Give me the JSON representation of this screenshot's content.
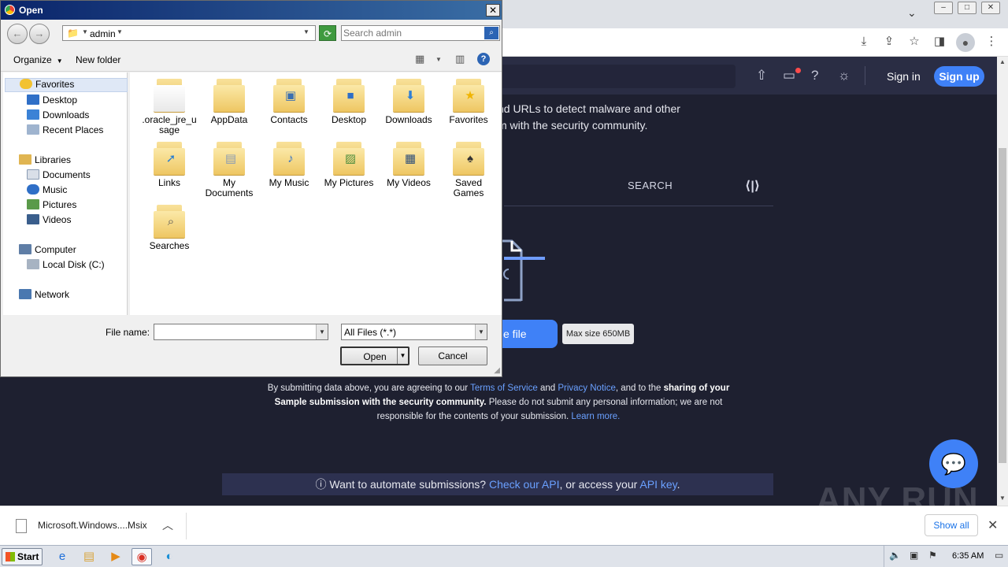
{
  "browser": {
    "window_controls": [
      "–",
      "□",
      "✕"
    ],
    "omnibar_icons": [
      "download-icon",
      "share-icon",
      "star-icon",
      "sidepanel-icon",
      "profile-icon",
      "menu-icon"
    ]
  },
  "page": {
    "header": {
      "sign_in": "Sign in",
      "sign_up": "Sign up"
    },
    "intro": [
      "nd URLs to detect malware and other",
      "m with the security community."
    ],
    "tab_search": "SEARCH",
    "choose_file": "e file",
    "max_size": "Max size 650MB",
    "legal": {
      "p1": "By submitting data above, you are agreeing to our ",
      "terms": "Terms of Service",
      "and": " and ",
      "privacy": "Privacy Notice",
      "p2": ", and to the ",
      "bold": "sharing of your Sample submission with the security community.",
      "p3": " Please do not submit any personal information; we are not responsible for the contents of your submission. ",
      "learn": "Learn more."
    },
    "api_bar": {
      "prefix": "ⓘ Want to automate submissions? ",
      "check_api": "Check our API",
      "middle": ", or access your ",
      "api_key": "API key",
      "suffix": "."
    },
    "watermark": "ANY RUN"
  },
  "download_bar": {
    "file_name": "Microsoft.Windows....Msix",
    "show_all": "Show all"
  },
  "taskbar": {
    "start": "Start",
    "clock": "6:35 AM"
  },
  "dialog": {
    "title": "Open",
    "address": "admin",
    "search_placeholder": "Search admin",
    "organize": "Organize",
    "new_folder": "New folder",
    "nav": {
      "favorites": "Favorites",
      "desktop": "Desktop",
      "downloads": "Downloads",
      "recent": "Recent Places",
      "libraries": "Libraries",
      "documents": "Documents",
      "music": "Music",
      "pictures": "Pictures",
      "videos": "Videos",
      "computer": "Computer",
      "local_disk": "Local Disk (C:)",
      "network": "Network"
    },
    "items": [
      ".oracle_jre_u sage",
      "AppData",
      "Contacts",
      "Desktop",
      "Downloads",
      "Favorites",
      "Links",
      "My Documents",
      "My Music",
      "My Pictures",
      "My Videos",
      "Saved Games",
      "Searches"
    ],
    "file_name_label": "File name:",
    "file_name_value": "",
    "file_type": "All Files (*.*)",
    "open": "Open",
    "cancel": "Cancel"
  }
}
